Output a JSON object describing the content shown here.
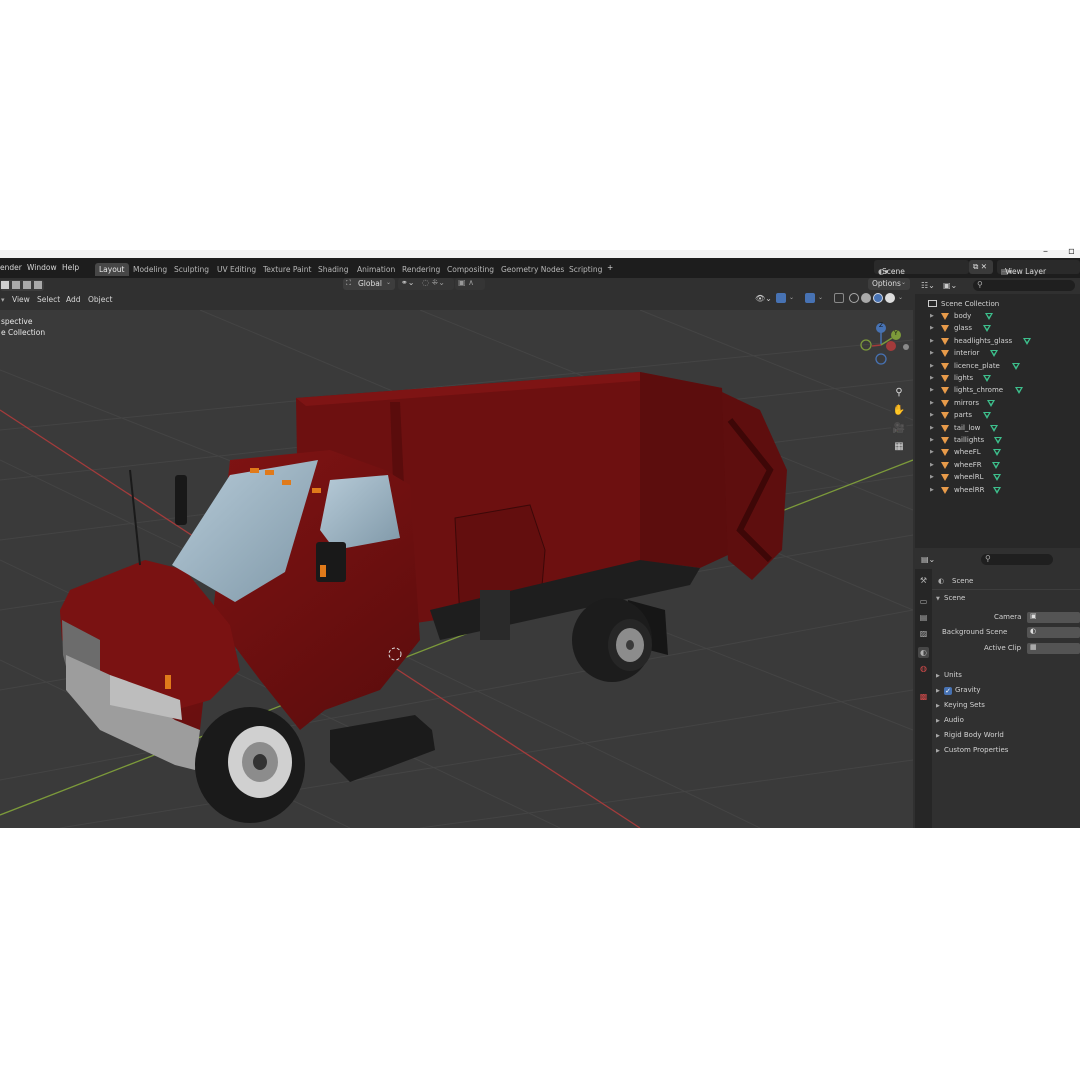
{
  "menu": {
    "render": "ender",
    "window": "Window",
    "help": "Help"
  },
  "workspaces": [
    "Layout",
    "Modeling",
    "Sculpting",
    "UV Editing",
    "Texture Paint",
    "Shading",
    "Animation",
    "Rendering",
    "Compositing",
    "Geometry Nodes",
    "Scripting"
  ],
  "add_workspace": "+",
  "scene_name": "Scene",
  "view_layer": "View Layer",
  "header": {
    "view": "View",
    "select": "Select",
    "add": "Add",
    "object": "Object",
    "orientation": "Global",
    "options": "Options"
  },
  "overlay": {
    "perspective": "spective",
    "collection": "e Collection"
  },
  "gizmo": {
    "z": "Z",
    "y": "Y"
  },
  "outliner": {
    "root": "Scene Collection",
    "items": [
      "body",
      "glass",
      "headlights_glass",
      "interior",
      "licence_plate",
      "lights",
      "lights_chrome",
      "mirrors",
      "parts",
      "tail_low",
      "taillights",
      "wheeFL",
      "wheeFR",
      "wheelRL",
      "wheelRR"
    ]
  },
  "properties": {
    "context": "Scene",
    "panel": "Scene",
    "camera_label": "Camera",
    "background_label": "Background Scene",
    "clip_label": "Active Clip",
    "sections": [
      "Units",
      "Gravity",
      "Keying Sets",
      "Audio",
      "Rigid Body World",
      "Custom Properties"
    ],
    "gravity_checked": true
  },
  "colors": {
    "truck": "#7a1212",
    "axis_x": "#a33b3b",
    "axis_y": "#7c9a3a",
    "accent": "#4772b3"
  }
}
